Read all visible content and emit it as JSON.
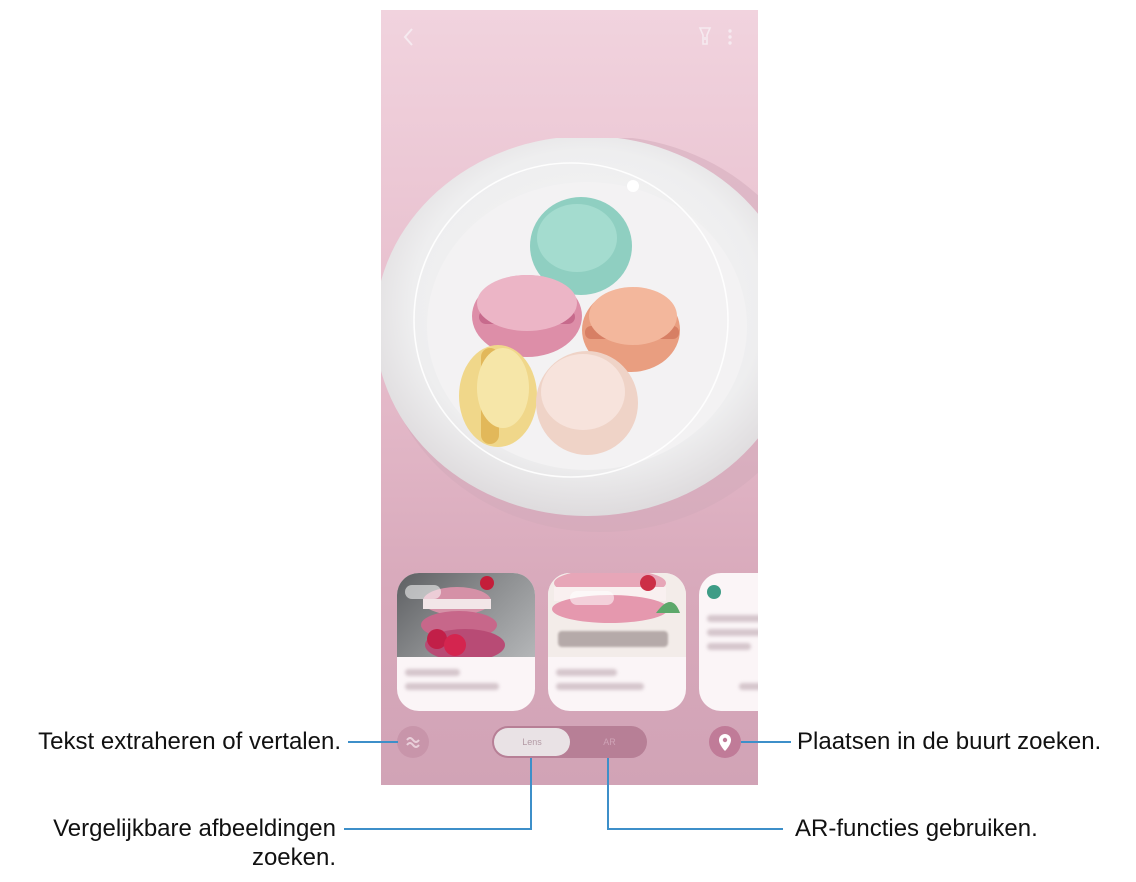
{
  "labels": {
    "text": "Tekst extraheren of vertalen.",
    "places": "Plaatsen in de buurt zoeken.",
    "similar_line1": "Vergelijkbare afbeeldingen",
    "similar_line2": "zoeken.",
    "ar": "AR-functies gebruiken."
  },
  "mode": {
    "lens": "Lens",
    "ar": "AR",
    "selected": "Lens"
  },
  "icons": {
    "back": "back-arrow-icon",
    "flash": "flashlight-icon",
    "menu": "more-options-icon",
    "text": "text-extract-icon",
    "places": "location-pin-icon"
  },
  "colors": {
    "callout": "#3d8fc9",
    "background": "#e6bccb"
  }
}
